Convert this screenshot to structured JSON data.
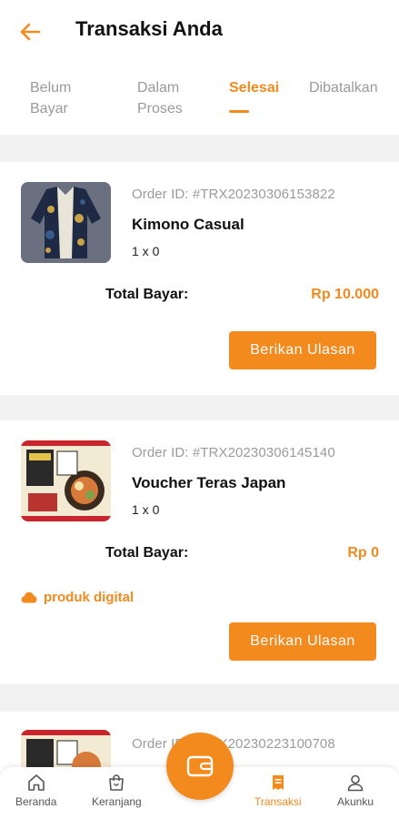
{
  "header": {
    "title": "Transaksi Anda"
  },
  "tabs": [
    {
      "line1": "Belum",
      "line2": "Bayar"
    },
    {
      "line1": "Dalam",
      "line2": "Proses"
    },
    {
      "line1": "Selesai",
      "line2": ""
    },
    {
      "line1": "Dibatalkan",
      "line2": ""
    }
  ],
  "orders": [
    {
      "order_id": "Order ID: #TRX20230306153822",
      "name": "Kimono Casual",
      "qty": "1 x 0",
      "total_label": "Total Bayar:",
      "total": "Rp 10.000",
      "button": "Berikan Ulasan"
    },
    {
      "order_id": "Order ID: #TRX20230306145140",
      "name": "Voucher Teras Japan",
      "qty": "1 x 0",
      "total_label": "Total Bayar:",
      "total": "Rp 0",
      "badge": "produk digital",
      "button": "Berikan Ulasan"
    },
    {
      "order_id": "Order ID: #TRX20230223100708"
    }
  ],
  "nav": {
    "items": [
      "Beranda",
      "Keranjang",
      "Transaksi",
      "Akunku"
    ]
  },
  "colors": {
    "accent": "#f28a1e"
  }
}
